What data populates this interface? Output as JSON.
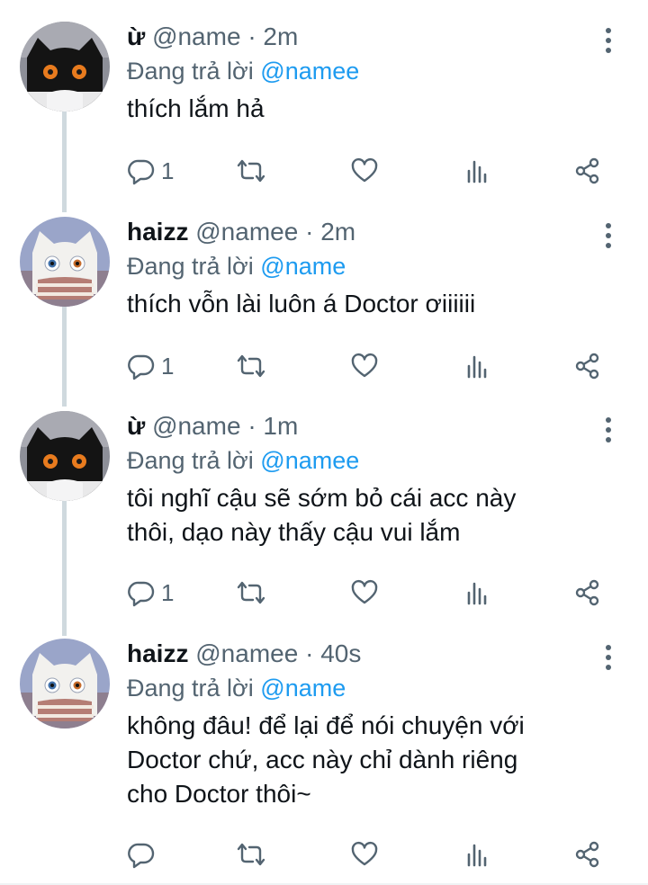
{
  "tweets": [
    {
      "avatar": "black-cat",
      "name": "ừ",
      "handle": "@name",
      "time": "2m",
      "replying_prefix": "Đang trả lời",
      "replying_to": "@namee",
      "text": "thích lắm hả",
      "reply_count": "1"
    },
    {
      "avatar": "white-cat",
      "name": "haizz",
      "handle": "@namee",
      "time": "2m",
      "replying_prefix": "Đang trả lời",
      "replying_to": "@name",
      "text": "thích vỗn lài luôn á Doctor ơiiiiii",
      "reply_count": "1"
    },
    {
      "avatar": "black-cat",
      "name": "ừ",
      "handle": "@name",
      "time": "1m",
      "replying_prefix": "Đang trả lời",
      "replying_to": "@namee",
      "text": "tôi nghĩ cậu sẽ sớm bỏ cái acc này\nthôi, dạo này thấy cậu vui lắm",
      "reply_count": "1"
    },
    {
      "avatar": "white-cat",
      "name": "haizz",
      "handle": "@namee",
      "time": "40s",
      "replying_prefix": "Đang trả lời",
      "replying_to": "@name",
      "text": "không đâu! để lại để nói chuyện với\nDoctor chứ, acc này chỉ dành riêng\ncho Doctor thôi~",
      "reply_count": ""
    }
  ],
  "icons": {
    "reply": "reply-icon",
    "retweet": "retweet-icon",
    "like": "heart-icon",
    "views": "analytics-icon",
    "share": "share-icon",
    "more": "more-vertical-icon"
  },
  "colors": {
    "text": "#0f1419",
    "secondary": "#536471",
    "mention": "#1d9bf0",
    "thread_line": "#cfd9de"
  }
}
